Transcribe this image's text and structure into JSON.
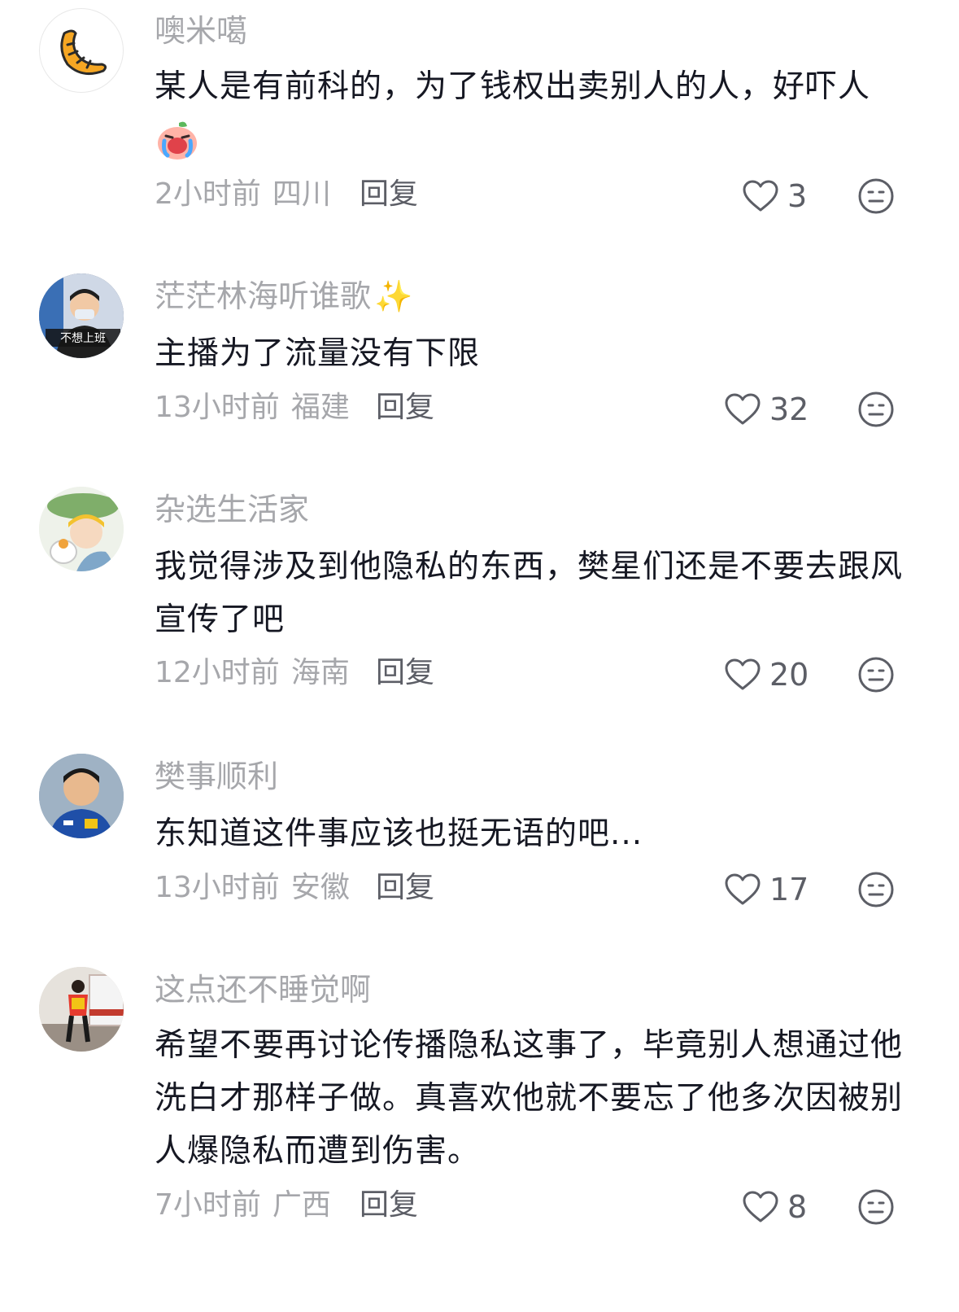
{
  "comments": [
    {
      "username": "噢米噶",
      "avatar": "croissant-avatar",
      "text": "某人是有前科的，为了钱权出卖别人的人，好吓人",
      "sticker": "crying-peach-sticker",
      "time": "2小时前",
      "location": "四川",
      "reply_label": "回复",
      "likes": "3"
    },
    {
      "username": "茫茫林海听谁歌",
      "username_emoji": "✨",
      "avatar": "boy-with-mask-avatar",
      "avatar_caption": "不想上班",
      "text": "主播为了流量没有下限",
      "time": "13小时前",
      "location": "福建",
      "reply_label": "回复",
      "likes": "32"
    },
    {
      "username": "杂选生活家",
      "avatar": "cartoon-girl-avatar",
      "text": "我觉得涉及到他隐私的东西，樊星们还是不要去跟风宣传了吧",
      "time": "12小时前",
      "location": "海南",
      "reply_label": "回复",
      "likes": "20"
    },
    {
      "username": "樊事顺利",
      "avatar": "athlete-portrait-avatar",
      "text": "东知道这件事应该也挺无语的吧...",
      "time": "13小时前",
      "location": "安徽",
      "reply_label": "回复",
      "likes": "17"
    },
    {
      "username": "这点还不睡觉啊",
      "avatar": "athlete-walking-avatar",
      "text": "希望不要再讨论传播隐私这事了，毕竟别人想通过他洗白才那样子做。真喜欢他就不要忘了他多次因被别人爆隐私而遭到伤害。",
      "time": "7小时前",
      "location": "广西",
      "reply_label": "回复",
      "likes": "8"
    }
  ],
  "icons": {
    "like": "heart-outline-icon",
    "dislike": "meh-face-icon"
  },
  "colors": {
    "username": "#a6a7ab",
    "body": "#161823",
    "meta": "#a6a7ab",
    "reply": "#5c5e66",
    "icon": "#5c5e66"
  }
}
